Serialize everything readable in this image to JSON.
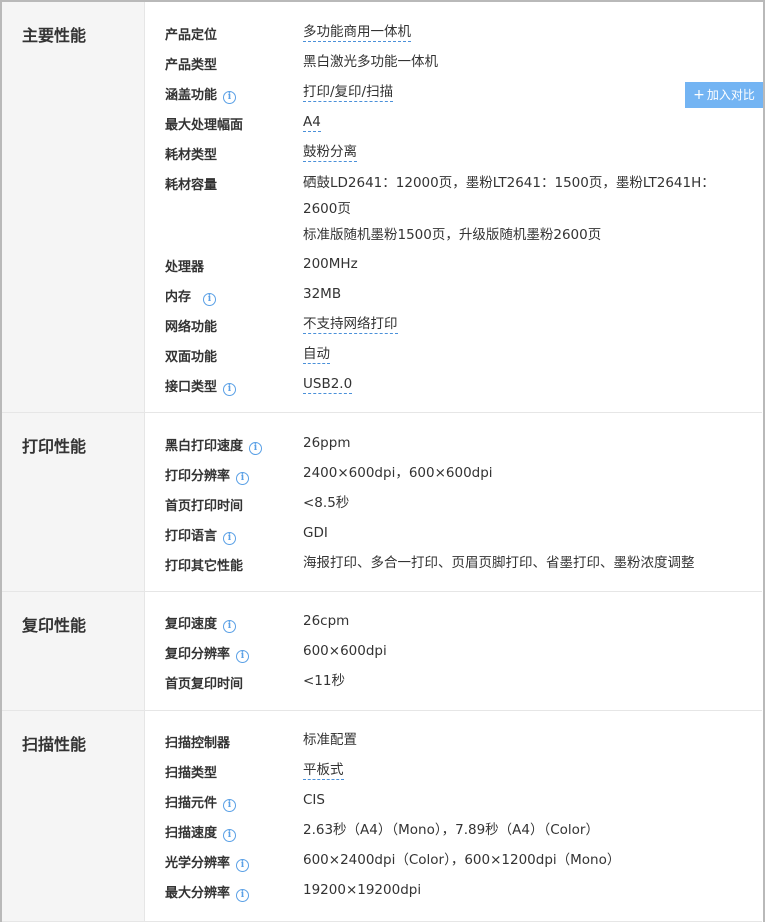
{
  "compare_button": {
    "plus": "+",
    "label": "加入对比"
  },
  "sections": [
    {
      "title": "主要性能",
      "rows": [
        {
          "label": "产品定位",
          "value": "多功能商用一体机",
          "link": true,
          "info": false
        },
        {
          "label": "产品类型",
          "value": "黑白激光多功能一体机",
          "link": false,
          "info": false
        },
        {
          "label": "涵盖功能",
          "value": "打印/复印/扫描",
          "link": true,
          "info": true
        },
        {
          "label": "最大处理幅面",
          "value": "A4",
          "link": true,
          "info": false
        },
        {
          "label": "耗材类型",
          "value": "鼓粉分离",
          "link": true,
          "info": false
        },
        {
          "label": "耗材容量",
          "value": "硒鼓LD2641：12000页，墨粉LT2641：1500页，墨粉LT2641H：2600页",
          "value2": "标准版随机墨粉1500页，升级版随机墨粉2600页",
          "link": false,
          "info": false
        },
        {
          "label": "处理器",
          "value": "200MHz",
          "link": false,
          "info": false
        },
        {
          "label": "内存",
          "value": "32MB",
          "link": false,
          "info": true
        },
        {
          "label": "网络功能",
          "value": "不支持网络打印",
          "link": true,
          "info": false
        },
        {
          "label": "双面功能",
          "value": "自动",
          "link": true,
          "info": false
        },
        {
          "label": "接口类型",
          "value": "USB2.0",
          "link": true,
          "info": true
        }
      ]
    },
    {
      "title": "打印性能",
      "rows": [
        {
          "label": "黑白打印速度",
          "value": "26ppm",
          "info": true
        },
        {
          "label": "打印分辨率",
          "value": "2400×600dpi，600×600dpi",
          "info": true
        },
        {
          "label": "首页打印时间",
          "value": "<8.5秒",
          "info": false
        },
        {
          "label": "打印语言",
          "value": "GDI",
          "info": true
        },
        {
          "label": "打印其它性能",
          "value": "海报打印、多合一打印、页眉页脚打印、省墨打印、墨粉浓度调整",
          "info": false
        }
      ]
    },
    {
      "title": "复印性能",
      "rows": [
        {
          "label": "复印速度",
          "value": "26cpm",
          "info": true
        },
        {
          "label": "复印分辨率",
          "value": "600×600dpi",
          "info": true
        },
        {
          "label": "首页复印时间",
          "value": "<11秒",
          "info": false
        }
      ]
    },
    {
      "title": "扫描性能",
      "rows": [
        {
          "label": "扫描控制器",
          "value": "标准配置",
          "info": false
        },
        {
          "label": "扫描类型",
          "value": "平板式",
          "link": true,
          "info": false
        },
        {
          "label": "扫描元件",
          "value": "CIS",
          "info": true
        },
        {
          "label": "扫描速度",
          "value": "2.63秒（A4）（Mono），7.89秒（A4）（Color）",
          "info": true
        },
        {
          "label": "光学分辨率",
          "value": "600×2400dpi（Color），600×1200dpi（Mono）",
          "info": true
        },
        {
          "label": "最大分辨率",
          "value": "19200×19200dpi",
          "info": true
        }
      ]
    }
  ]
}
